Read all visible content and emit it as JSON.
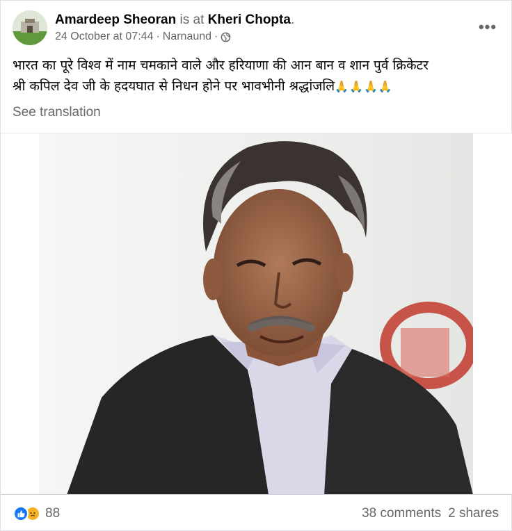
{
  "post": {
    "author": "Amardeep Sheoran",
    "connector": "is at",
    "location": "Kheri Chopta",
    "location_suffix": ".",
    "date": "24 October at 07:44",
    "place": "Narnaund",
    "separator": "·",
    "audience_icon": "globe-icon",
    "more_label": "•••",
    "text_line_1": "भारत का पूरे विश्व में नाम चमकाने वाले और हरियाणा की आन बान व शान पुर्व क्रिकेटर",
    "text_line_2": "श्री कपिल देव जी के हदयघात से निधन होने पर भावभीनी श्रद्धांजलि",
    "emoji_suffix": "🙏🙏🙏🙏",
    "see_translation": "See translation"
  },
  "engagement": {
    "reaction_icons": [
      "like-icon",
      "sad-icon"
    ],
    "reaction_count": "88",
    "comments": "38 comments",
    "shares": "2 shares"
  },
  "colors": {
    "like": "#1877f2",
    "sad": "#f7b125",
    "secondary_text": "#65676b"
  }
}
